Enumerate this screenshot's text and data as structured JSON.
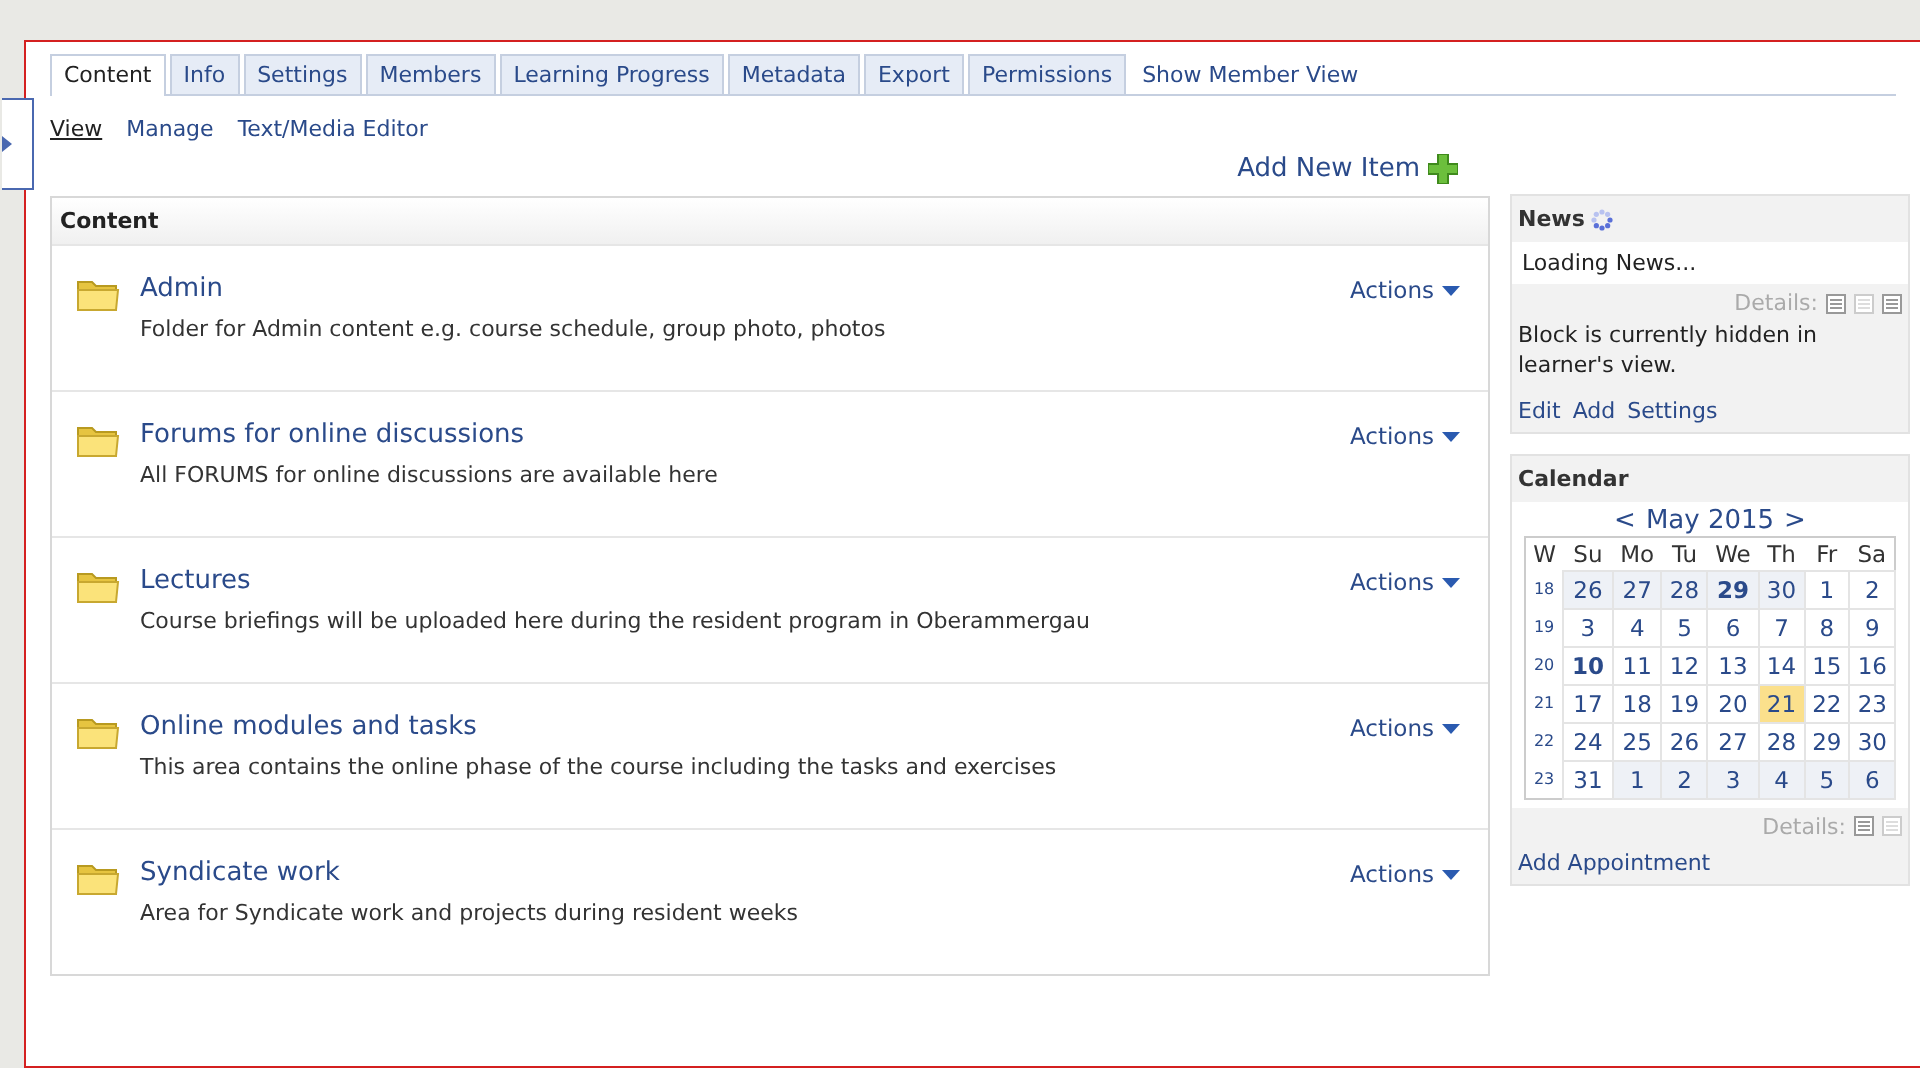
{
  "tabs": [
    {
      "label": "Content",
      "selected": true
    },
    {
      "label": "Info",
      "selected": false
    },
    {
      "label": "Settings",
      "selected": false
    },
    {
      "label": "Members",
      "selected": false
    },
    {
      "label": "Learning Progress",
      "selected": false
    },
    {
      "label": "Metadata",
      "selected": false
    },
    {
      "label": "Export",
      "selected": false
    },
    {
      "label": "Permissions",
      "selected": false
    }
  ],
  "member_view_link": "Show Member View",
  "subtabs": [
    {
      "label": "View",
      "selected": true
    },
    {
      "label": "Manage",
      "selected": false
    },
    {
      "label": "Text/Media Editor",
      "selected": false
    }
  ],
  "add_new_item": "Add New Item",
  "content": {
    "title": "Content",
    "items": [
      {
        "title": "Admin",
        "description": "Folder for Admin content e.g. course schedule, group photo, photos",
        "actions": "Actions"
      },
      {
        "title": "Forums for online discussions",
        "description": "All FORUMS for online discussions are available here",
        "actions": "Actions"
      },
      {
        "title": "Lectures",
        "description": "Course briefings will be uploaded here during the resident program in Oberammergau",
        "actions": "Actions"
      },
      {
        "title": "Online modules and tasks",
        "description": "This area contains the online phase of the course including the tasks and exercises",
        "actions": "Actions"
      },
      {
        "title": "Syndicate work",
        "description": "Area for Syndicate work and projects during resident weeks",
        "actions": "Actions"
      }
    ]
  },
  "news": {
    "title": "News",
    "loading": "Loading News...",
    "details": "Details:",
    "hidden_note": "Block is currently hidden in learner's view.",
    "links": [
      "Edit",
      "Add",
      "Settings"
    ]
  },
  "calendar": {
    "title": "Calendar",
    "prev": "<",
    "month": "May 2015",
    "next": ">",
    "headers": [
      "W",
      "Su",
      "Mo",
      "Tu",
      "We",
      "Th",
      "Fr",
      "Sa"
    ],
    "weeks": [
      {
        "week": "18",
        "days": [
          {
            "d": "26",
            "other": true,
            "bold": false,
            "today": false
          },
          {
            "d": "27",
            "other": true,
            "bold": false,
            "today": false
          },
          {
            "d": "28",
            "other": true,
            "bold": false,
            "today": false
          },
          {
            "d": "29",
            "other": true,
            "bold": true,
            "today": false
          },
          {
            "d": "30",
            "other": true,
            "bold": false,
            "today": false
          },
          {
            "d": "1",
            "other": false,
            "bold": false,
            "today": false
          },
          {
            "d": "2",
            "other": false,
            "bold": false,
            "today": false
          }
        ]
      },
      {
        "week": "19",
        "days": [
          {
            "d": "3",
            "other": false,
            "bold": false,
            "today": false
          },
          {
            "d": "4",
            "other": false,
            "bold": false,
            "today": false
          },
          {
            "d": "5",
            "other": false,
            "bold": false,
            "today": false
          },
          {
            "d": "6",
            "other": false,
            "bold": false,
            "today": false
          },
          {
            "d": "7",
            "other": false,
            "bold": false,
            "today": false
          },
          {
            "d": "8",
            "other": false,
            "bold": false,
            "today": false
          },
          {
            "d": "9",
            "other": false,
            "bold": false,
            "today": false
          }
        ]
      },
      {
        "week": "20",
        "days": [
          {
            "d": "10",
            "other": false,
            "bold": true,
            "today": false
          },
          {
            "d": "11",
            "other": false,
            "bold": false,
            "today": false
          },
          {
            "d": "12",
            "other": false,
            "bold": false,
            "today": false
          },
          {
            "d": "13",
            "other": false,
            "bold": false,
            "today": false
          },
          {
            "d": "14",
            "other": false,
            "bold": false,
            "today": false
          },
          {
            "d": "15",
            "other": false,
            "bold": false,
            "today": false
          },
          {
            "d": "16",
            "other": false,
            "bold": false,
            "today": false
          }
        ]
      },
      {
        "week": "21",
        "days": [
          {
            "d": "17",
            "other": false,
            "bold": false,
            "today": false
          },
          {
            "d": "18",
            "other": false,
            "bold": false,
            "today": false
          },
          {
            "d": "19",
            "other": false,
            "bold": false,
            "today": false
          },
          {
            "d": "20",
            "other": false,
            "bold": false,
            "today": false
          },
          {
            "d": "21",
            "other": false,
            "bold": false,
            "today": true
          },
          {
            "d": "22",
            "other": false,
            "bold": false,
            "today": false
          },
          {
            "d": "23",
            "other": false,
            "bold": false,
            "today": false
          }
        ]
      },
      {
        "week": "22",
        "days": [
          {
            "d": "24",
            "other": false,
            "bold": false,
            "today": false
          },
          {
            "d": "25",
            "other": false,
            "bold": false,
            "today": false
          },
          {
            "d": "26",
            "other": false,
            "bold": false,
            "today": false
          },
          {
            "d": "27",
            "other": false,
            "bold": false,
            "today": false
          },
          {
            "d": "28",
            "other": false,
            "bold": false,
            "today": false
          },
          {
            "d": "29",
            "other": false,
            "bold": false,
            "today": false
          },
          {
            "d": "30",
            "other": false,
            "bold": false,
            "today": false
          }
        ]
      },
      {
        "week": "23",
        "days": [
          {
            "d": "31",
            "other": false,
            "bold": false,
            "today": false
          },
          {
            "d": "1",
            "other": true,
            "bold": false,
            "today": false
          },
          {
            "d": "2",
            "other": true,
            "bold": false,
            "today": false
          },
          {
            "d": "3",
            "other": true,
            "bold": false,
            "today": false
          },
          {
            "d": "4",
            "other": true,
            "bold": false,
            "today": false
          },
          {
            "d": "5",
            "other": true,
            "bold": false,
            "today": false
          },
          {
            "d": "6",
            "other": true,
            "bold": false,
            "today": false
          }
        ]
      }
    ],
    "details": "Details:",
    "add_appointment": "Add Appointment"
  }
}
